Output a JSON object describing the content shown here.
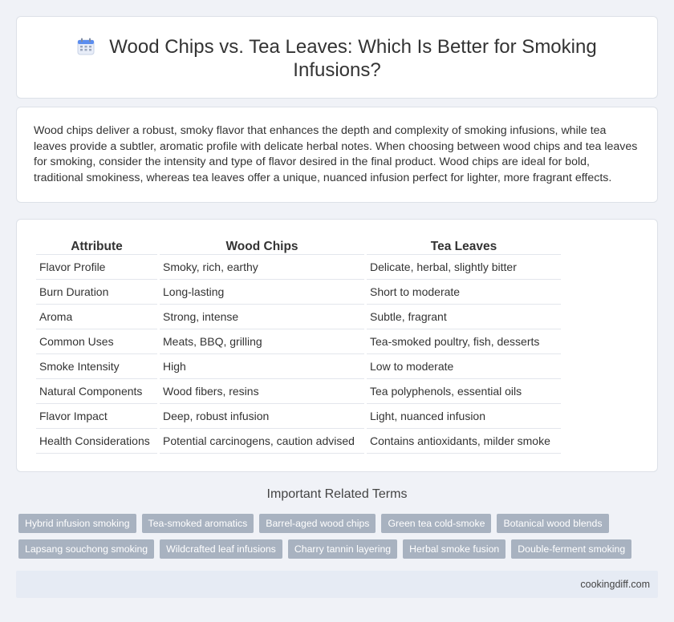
{
  "header": {
    "title": "Wood Chips vs. Tea Leaves: Which Is Better for Smoking Infusions?",
    "icon": "calendar-icon"
  },
  "summary": {
    "text": "Wood chips deliver a robust, smoky flavor that enhances the depth and complexity of smoking infusions, while tea leaves provide a subtler, aromatic profile with delicate herbal notes. When choosing between wood chips and tea leaves for smoking, consider the intensity and type of flavor desired in the final product. Wood chips are ideal for bold, traditional smokiness, whereas tea leaves offer a unique, nuanced infusion perfect for lighter, more fragrant effects."
  },
  "table": {
    "headers": [
      "Attribute",
      "Wood Chips",
      "Tea Leaves"
    ],
    "rows": [
      [
        "Flavor Profile",
        "Smoky, rich, earthy",
        "Delicate, herbal, slightly bitter"
      ],
      [
        "Burn Duration",
        "Long-lasting",
        "Short to moderate"
      ],
      [
        "Aroma",
        "Strong, intense",
        "Subtle, fragrant"
      ],
      [
        "Common Uses",
        "Meats, BBQ, grilling",
        "Tea-smoked poultry, fish, desserts"
      ],
      [
        "Smoke Intensity",
        "High",
        "Low to moderate"
      ],
      [
        "Natural Components",
        "Wood fibers, resins",
        "Tea polyphenols, essential oils"
      ],
      [
        "Flavor Impact",
        "Deep, robust infusion",
        "Light, nuanced infusion"
      ],
      [
        "Health Considerations",
        "Potential carcinogens, caution advised",
        "Contains antioxidants, milder smoke"
      ]
    ]
  },
  "related": {
    "title": "Important Related Terms",
    "tags": [
      "Hybrid infusion smoking",
      "Tea-smoked aromatics",
      "Barrel-aged wood chips",
      "Green tea cold-smoke",
      "Botanical wood blends",
      "Lapsang souchong smoking",
      "Wildcrafted leaf infusions",
      "Charry tannin layering",
      "Herbal smoke fusion",
      "Double-ferment smoking"
    ]
  },
  "footer": {
    "site": "cookingdiff.com"
  },
  "colors": {
    "background": "#f0f2f7",
    "tag_background": "#a8b2c0",
    "footer_background": "#e6ebf4",
    "icon_accent": "#5b8def"
  }
}
